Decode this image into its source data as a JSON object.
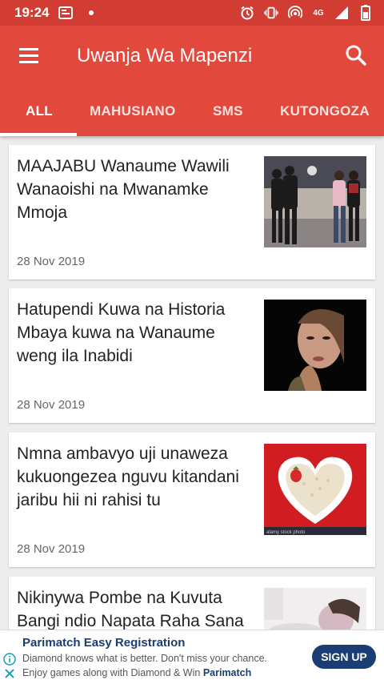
{
  "status_bar": {
    "time": "19:24",
    "network": "4G",
    "icons": [
      "notification-icon",
      "dot-icon",
      "alarm-icon",
      "vibrate-icon",
      "hotspot-icon",
      "signal-icon",
      "battery-icon"
    ]
  },
  "toolbar": {
    "title": "Uwanja Wa Mapenzi",
    "menu_icon": "hamburger-icon",
    "search_icon": "search-icon"
  },
  "tabs": [
    {
      "label": "ALL",
      "active": true
    },
    {
      "label": "MAHUSIANO",
      "active": false
    },
    {
      "label": "SMS",
      "active": false
    },
    {
      "label": "KUTONGOZA",
      "active": false
    }
  ],
  "articles": [
    {
      "title": "MAAJABU Wanaume Wawili Wanaoishi na Mwanamke Mmoja",
      "date": "28 Nov 2019"
    },
    {
      "title": "Hatupendi Kuwa na Historia Mbaya kuwa na Wanaume weng ila Inabidi",
      "date": "28 Nov 2019"
    },
    {
      "title": "Nmna ambavyo uji unaweza kukuongezea nguvu kitandani jaribu hii ni rahisi tu",
      "date": "28 Nov 2019",
      "image_caption": "alamy stock photo"
    },
    {
      "title": "Nikinywa Pombe na Kuvuta Bangi ndio Napata Raha Sana",
      "date": ""
    }
  ],
  "ad": {
    "title": "Parimatch Easy Registration",
    "line1": "Diamond knows what is better. Don't miss your chance.",
    "line2_prefix": "Enjoy games along with Diamond & Win ",
    "line2_brand": "Parimatch",
    "button": "SIGN UP"
  },
  "colors": {
    "status_bar": "#d23d33",
    "toolbar": "#e2483c",
    "ad_accent": "#1a3d73"
  }
}
